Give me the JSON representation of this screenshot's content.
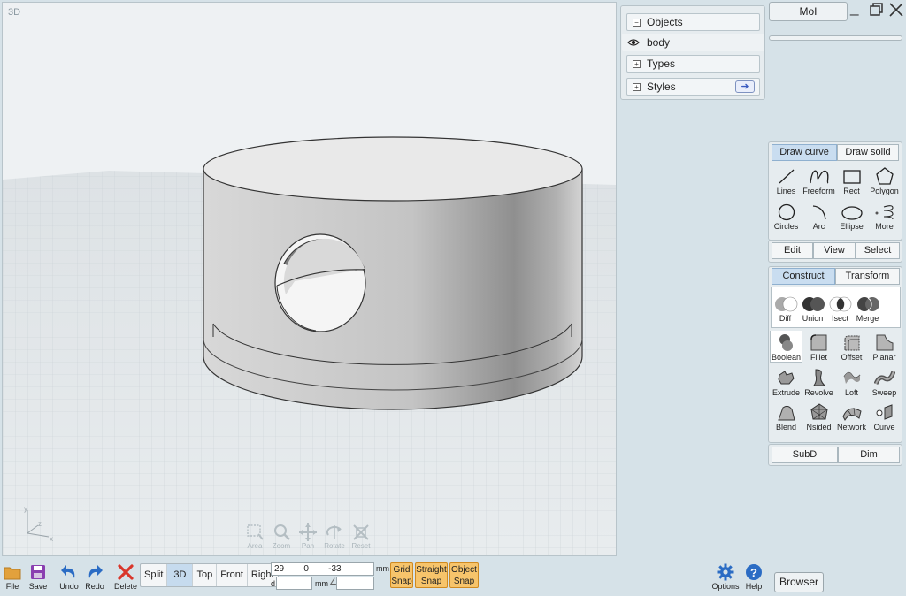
{
  "viewport": {
    "label": "3D",
    "nav_tools": [
      {
        "name": "area-zoom-tool",
        "label": "Area",
        "icon": "area-zoom-icon"
      },
      {
        "name": "zoom-tool",
        "label": "Zoom",
        "icon": "magnifier-icon"
      },
      {
        "name": "pan-tool",
        "label": "Pan",
        "icon": "pan-arrows-icon"
      },
      {
        "name": "rotate-tool",
        "label": "Rotate",
        "icon": "rotate-icon"
      },
      {
        "name": "reset-tool",
        "label": "Reset",
        "icon": "reset-icon"
      }
    ],
    "axes": {
      "x": "x",
      "y": "y",
      "z": "z"
    }
  },
  "window": {
    "title_button": "MoI",
    "minimize": "minimize-icon",
    "restore": "restore-icon",
    "close": "close-icon"
  },
  "scene_panel": {
    "objects_label": "Objects",
    "body_label": "body",
    "types_label": "Types",
    "styles_label": "Styles"
  },
  "draw_tabs": {
    "draw_curve": "Draw curve",
    "draw_solid": "Draw solid"
  },
  "draw_tools": [
    {
      "name": "lines-tool",
      "label": "Lines",
      "icon": "line-icon"
    },
    {
      "name": "freeform-tool",
      "label": "Freeform",
      "icon": "freeform-icon"
    },
    {
      "name": "rect-tool",
      "label": "Rect",
      "icon": "rectangle-icon"
    },
    {
      "name": "polygon-tool",
      "label": "Polygon",
      "icon": "polygon-icon"
    },
    {
      "name": "circles-tool",
      "label": "Circles",
      "icon": "circle-icon"
    },
    {
      "name": "arc-tool",
      "label": "Arc",
      "icon": "arc-icon"
    },
    {
      "name": "ellipse-tool",
      "label": "Ellipse",
      "icon": "ellipse-icon"
    },
    {
      "name": "more-tool",
      "label": "More",
      "icon": "spiral-icon"
    }
  ],
  "edit_tabs": {
    "edit": "Edit",
    "view": "View",
    "select": "Select"
  },
  "construct_tabs": {
    "construct": "Construct",
    "transform": "Transform"
  },
  "boolean_tools": [
    {
      "name": "diff-tool",
      "label": "Diff",
      "icon": "boolean-diff-icon"
    },
    {
      "name": "union-tool",
      "label": "Union",
      "icon": "boolean-union-icon"
    },
    {
      "name": "isect-tool",
      "label": "Isect",
      "icon": "boolean-isect-icon"
    },
    {
      "name": "merge-tool",
      "label": "Merge",
      "icon": "boolean-merge-icon"
    }
  ],
  "construct_tools": [
    {
      "name": "boolean-tool",
      "label": "Boolean",
      "icon": "boolean-icon"
    },
    {
      "name": "fillet-tool",
      "label": "Fillet",
      "icon": "fillet-icon"
    },
    {
      "name": "offset-tool",
      "label": "Offset",
      "icon": "offset-icon"
    },
    {
      "name": "planar-tool",
      "label": "Planar",
      "icon": "planar-icon"
    },
    {
      "name": "extrude-tool",
      "label": "Extrude",
      "icon": "extrude-icon"
    },
    {
      "name": "revolve-tool",
      "label": "Revolve",
      "icon": "revolve-icon"
    },
    {
      "name": "loft-tool",
      "label": "Loft",
      "icon": "loft-icon"
    },
    {
      "name": "sweep-tool",
      "label": "Sweep",
      "icon": "sweep-icon"
    },
    {
      "name": "blend-tool",
      "label": "Blend",
      "icon": "blend-icon"
    },
    {
      "name": "nsided-tool",
      "label": "Nsided",
      "icon": "nsided-icon"
    },
    {
      "name": "network-tool",
      "label": "Network",
      "icon": "network-icon"
    },
    {
      "name": "curve-tool",
      "label": "Curve",
      "icon": "curve-icon"
    }
  ],
  "bottom_tabs": {
    "subd": "SubD",
    "dim": "Dim"
  },
  "bottom_bar": {
    "file": "File",
    "save": "Save",
    "undo": "Undo",
    "redo": "Redo",
    "delete": "Delete",
    "views": [
      "Split",
      "3D",
      "Top",
      "Front",
      "Right"
    ],
    "active_view": "3D",
    "coords": "29        0        -33",
    "unit": "mm",
    "d_label": "d",
    "d_unit": "mm",
    "angle_symbol": "∠",
    "grid_snap": [
      "Grid",
      "Snap"
    ],
    "straight_snap": [
      "Straight",
      "Snap"
    ],
    "object_snap": [
      "Object",
      "Snap"
    ],
    "options": "Options",
    "help": "Help",
    "browser": "Browser"
  },
  "colors": {
    "accent_tab": "#c9ddf0",
    "snap": "#f7c46b",
    "icon_blue": "#2b6cc4",
    "delete_red": "#d9362b"
  }
}
